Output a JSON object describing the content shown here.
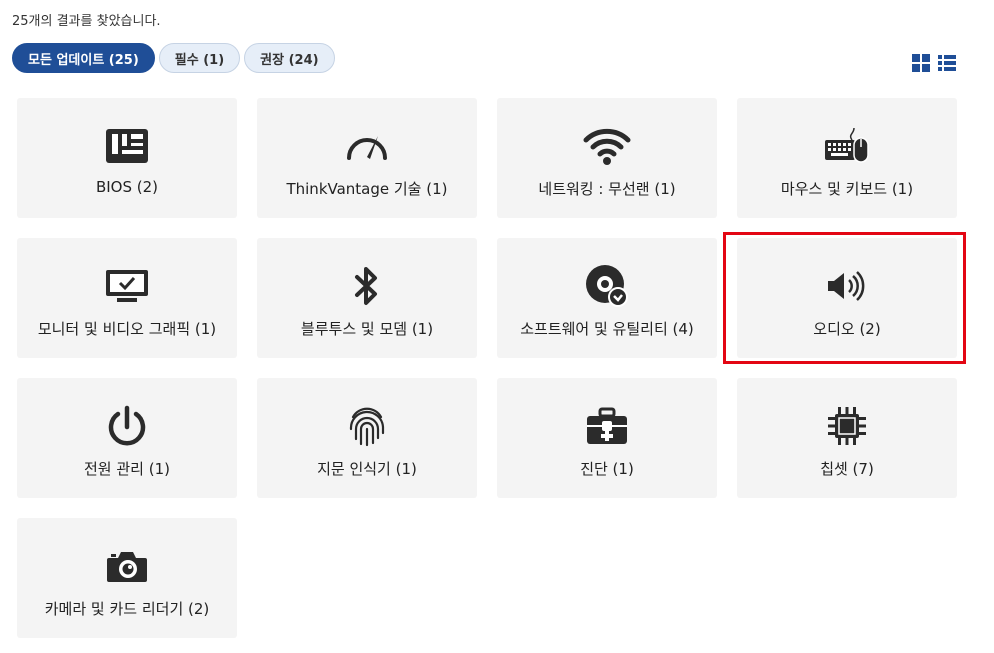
{
  "results_text": "25개의 결과를 찾았습니다.",
  "filters": [
    {
      "label": "모든 업데이트 (25)",
      "active": true
    },
    {
      "label": "필수 (1)",
      "active": false
    },
    {
      "label": "권장 (24)",
      "active": false
    }
  ],
  "colors": {
    "accent": "#1f4e97",
    "card_bg": "#f4f4f4",
    "highlight": "#e30613",
    "icon": "#2b2b2b"
  },
  "categories": [
    {
      "label": "BIOS (2)",
      "icon": "bios-chip-icon"
    },
    {
      "label": "ThinkVantage 기술 (1)",
      "icon": "speedometer-icon"
    },
    {
      "label": "네트워킹 : 무선랜 (1)",
      "icon": "wifi-icon"
    },
    {
      "label": "마우스 및 키보드 (1)",
      "icon": "keyboard-mouse-icon"
    },
    {
      "label": "모니터 및 비디오 그래픽 (1)",
      "icon": "monitor-icon"
    },
    {
      "label": "블루투스 및 모뎀 (1)",
      "icon": "bluetooth-icon"
    },
    {
      "label": "소프트웨어 및 유틸리티 (4)",
      "icon": "software-disc-icon"
    },
    {
      "label": "오디오 (2)",
      "icon": "speaker-icon",
      "highlighted": true
    },
    {
      "label": "전원 관리 (1)",
      "icon": "power-icon"
    },
    {
      "label": "지문 인식기 (1)",
      "icon": "fingerprint-icon"
    },
    {
      "label": "진단 (1)",
      "icon": "toolbox-icon"
    },
    {
      "label": "칩셋 (7)",
      "icon": "chipset-icon"
    },
    {
      "label": "카메라 및 카드 리더기 (2)",
      "icon": "camera-icon"
    }
  ]
}
